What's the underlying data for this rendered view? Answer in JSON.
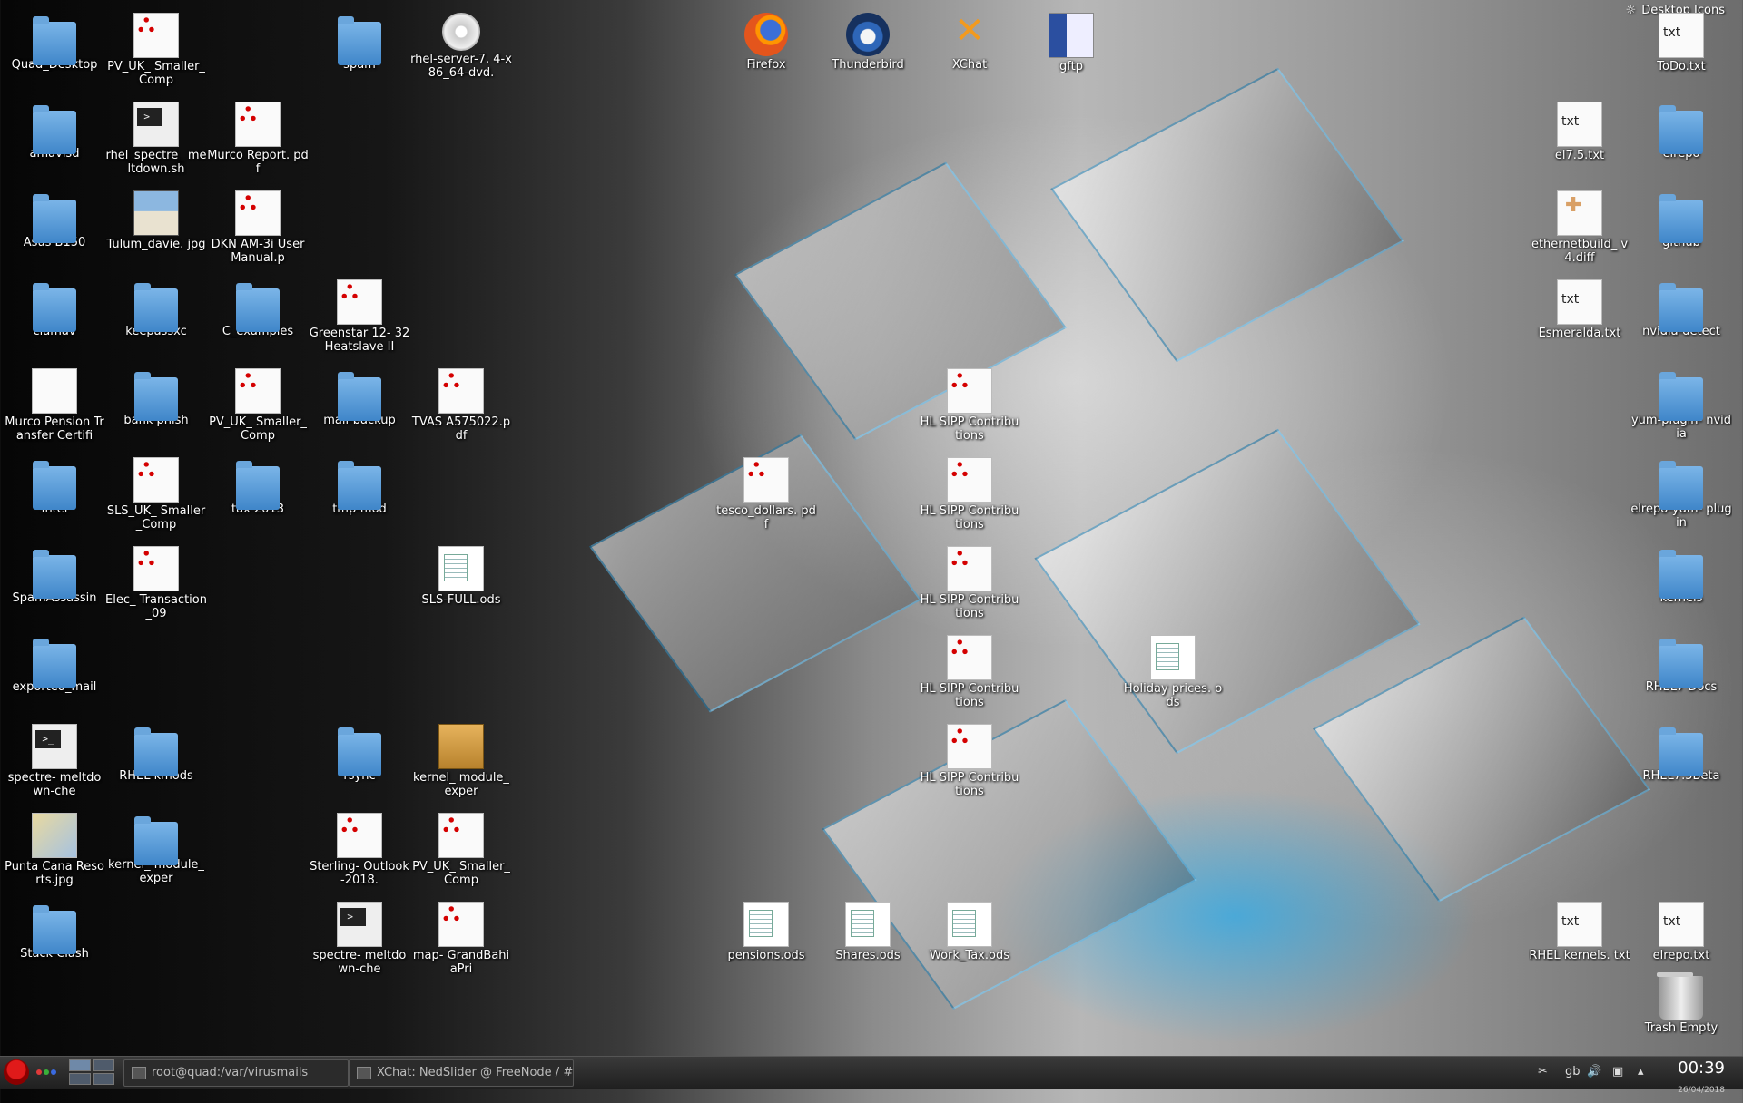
{
  "desktop": {
    "toolbox_label": "Desktop Icons",
    "icons": [
      {
        "label": "Quad_Desktop",
        "type": "folder"
      },
      {
        "label": "PV_UK_ Smaller_Comp",
        "type": "pdf"
      },
      {
        "label": "spam",
        "type": "folder"
      },
      {
        "label": "rhel-server-7. 4-x86_64-dvd.",
        "type": "disc"
      },
      {
        "label": "Firefox",
        "type": "firefox"
      },
      {
        "label": "Thunderbird",
        "type": "thunderbird"
      },
      {
        "label": "XChat",
        "type": "xchat"
      },
      {
        "label": "gftp",
        "type": "gftp"
      },
      {
        "label": "ToDo.txt",
        "type": "txt"
      },
      {
        "label": "amavisd",
        "type": "folder"
      },
      {
        "label": "rhel_spectre_ meltdown.sh",
        "type": "sh"
      },
      {
        "label": "Murco Report. pdf",
        "type": "pdf"
      },
      {
        "label": "el7.5.txt",
        "type": "txt"
      },
      {
        "label": "elrepo",
        "type": "folder"
      },
      {
        "label": "Asus B150",
        "type": "folder"
      },
      {
        "label": "Tulum_davie. jpg",
        "type": "photo"
      },
      {
        "label": "DKN AM-3i User Manual.p",
        "type": "pdf"
      },
      {
        "label": "ethernetbuild_ v4.diff",
        "type": "diff"
      },
      {
        "label": "github",
        "type": "folder"
      },
      {
        "label": "clamav",
        "type": "folder"
      },
      {
        "label": "keepassxc",
        "type": "folder"
      },
      {
        "label": "C_examples",
        "type": "folder"
      },
      {
        "label": "Greenstar 12- 32 Heatslave II",
        "type": "pdf"
      },
      {
        "label": "Esmeralda.txt",
        "type": "txt"
      },
      {
        "label": "nvidia-detect",
        "type": "folder"
      },
      {
        "label": "Murco Pension Transfer Certifi",
        "type": "doc"
      },
      {
        "label": "bank phish",
        "type": "folder"
      },
      {
        "label": "PV_UK_ Smaller_Comp",
        "type": "pdf"
      },
      {
        "label": "mail-backup",
        "type": "folder"
      },
      {
        "label": "TVAS A575022.pdf",
        "type": "pdf"
      },
      {
        "label": "HL SIPP Contributions",
        "type": "pdf"
      },
      {
        "label": "yum-plugin- nvidia",
        "type": "folder"
      },
      {
        "label": "Intel",
        "type": "folder"
      },
      {
        "label": "SLS_UK_ Smaller_Comp",
        "type": "pdf"
      },
      {
        "label": "tax 2013",
        "type": "folder"
      },
      {
        "label": "tmp-mod",
        "type": "folder"
      },
      {
        "label": "tesco_dollars. pdf",
        "type": "pdf"
      },
      {
        "label": "HL SIPP Contributions",
        "type": "pdf"
      },
      {
        "label": "elrepo-yum- plugin",
        "type": "folder"
      },
      {
        "label": "SpamAssassin",
        "type": "folder"
      },
      {
        "label": "Elec_ Transaction_09",
        "type": "pdf"
      },
      {
        "label": "SLS-FULL.ods",
        "type": "ods"
      },
      {
        "label": "HL SIPP Contributions",
        "type": "pdf"
      },
      {
        "label": "kernels",
        "type": "folder"
      },
      {
        "label": "exported_mail",
        "type": "folder"
      },
      {
        "label": "HL SIPP Contributions",
        "type": "pdf"
      },
      {
        "label": "Holiday prices. ods",
        "type": "ods"
      },
      {
        "label": "RHEL7 Docs",
        "type": "folder"
      },
      {
        "label": "spectre- meltdown-che",
        "type": "sh"
      },
      {
        "label": "RHEL kmods",
        "type": "folder"
      },
      {
        "label": "rsync",
        "type": "folder"
      },
      {
        "label": "kernel_ module_exper",
        "type": "pkg"
      },
      {
        "label": "HL SIPP Contributions",
        "type": "pdf"
      },
      {
        "label": "RHEL7.5Beta",
        "type": "folder"
      },
      {
        "label": "Punta Cana Resorts.jpg",
        "type": "map"
      },
      {
        "label": "kernel_ module_exper",
        "type": "folder"
      },
      {
        "label": "Sterling- Outlook-2018.",
        "type": "pdf"
      },
      {
        "label": "PV_UK_ Smaller_Comp",
        "type": "pdf"
      },
      {
        "label": "Stack Clash",
        "type": "folder"
      },
      {
        "label": "spectre- meltdown-che",
        "type": "sh"
      },
      {
        "label": "map- GrandBahiaPri",
        "type": "pdf"
      },
      {
        "label": "pensions.ods",
        "type": "ods"
      },
      {
        "label": "Shares.ods",
        "type": "ods"
      },
      {
        "label": "Work_Tax.ods",
        "type": "ods"
      },
      {
        "label": "RHEL kernels. txt",
        "type": "txt"
      },
      {
        "label": "elrepo.txt",
        "type": "txt"
      },
      {
        "label": "Trash Empty",
        "type": "trash"
      }
    ]
  },
  "taskbar": {
    "tasks": [
      {
        "label": "root@quad:/var/virusmails"
      },
      {
        "label": "XChat: NedSlider @ FreeNode / #"
      }
    ],
    "tray": {
      "keyboard_layout": "gb"
    },
    "clock": {
      "time": "00:39",
      "date": "26/04/2018"
    },
    "colors": {
      "dot1": "#e03a3a",
      "dot2": "#3ab03a",
      "dot3": "#3a6ae0"
    }
  }
}
